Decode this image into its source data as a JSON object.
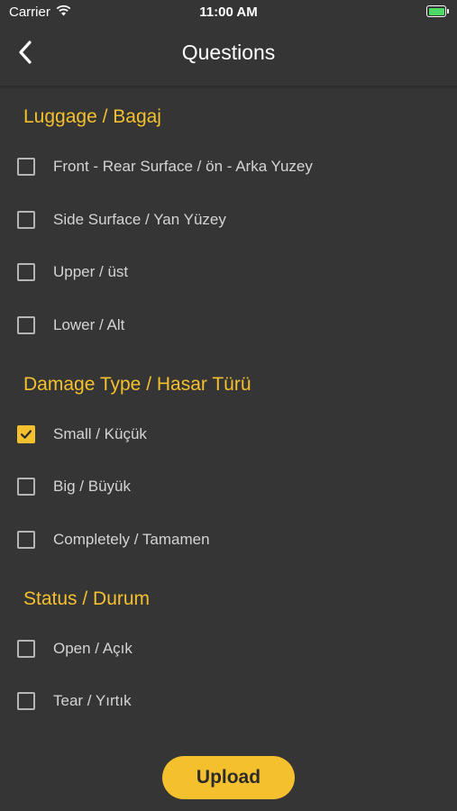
{
  "status_bar": {
    "carrier": "Carrier",
    "time": "11:00 AM",
    "battery_color": "#4cd964"
  },
  "nav": {
    "title": "Questions",
    "back_icon": "chevron-left-icon"
  },
  "sections": [
    {
      "title": "Luggage / Bagaj",
      "options": [
        {
          "label": "Front - Rear Surface / ön - Arka Yuzey",
          "checked": false
        },
        {
          "label": "Side Surface / Yan Yüzey",
          "checked": false
        },
        {
          "label": "Upper / üst",
          "checked": false
        },
        {
          "label": "Lower / Alt",
          "checked": false
        }
      ]
    },
    {
      "title": "Damage Type / Hasar Türü",
      "options": [
        {
          "label": "Small / Küçük",
          "checked": true
        },
        {
          "label": "Big / Büyük",
          "checked": false
        },
        {
          "label": "Completely / Tamamen",
          "checked": false
        }
      ]
    },
    {
      "title": "Status / Durum",
      "options": [
        {
          "label": "Open / Açık",
          "checked": false
        },
        {
          "label": "Tear / Yırtık",
          "checked": false
        }
      ]
    }
  ],
  "upload_label": "Upload",
  "colors": {
    "accent": "#f5c02e",
    "background": "#353535"
  }
}
